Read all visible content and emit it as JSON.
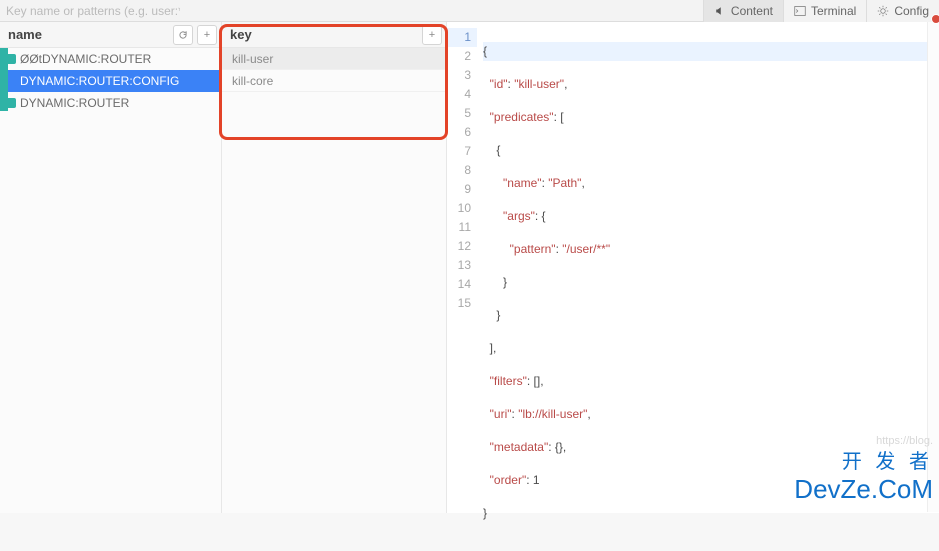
{
  "search": {
    "placeholder": "Key name or patterns (e.g. user:*)"
  },
  "tabs": {
    "content": "Content",
    "terminal": "Terminal",
    "config": "Config"
  },
  "panels": {
    "name": {
      "title": "name",
      "items": [
        {
          "label": "ØØtDYNAMIC:ROUTER",
          "color": "teal",
          "selected": false
        },
        {
          "label": "DYNAMIC:ROUTER:CONFIG",
          "color": "blue",
          "selected": true
        },
        {
          "label": "DYNAMIC:ROUTER",
          "color": "teal",
          "selected": false
        }
      ]
    },
    "key": {
      "title": "key",
      "items": [
        {
          "label": "kill-user",
          "selected": true
        },
        {
          "label": "kill-core",
          "selected": false
        }
      ]
    }
  },
  "code": {
    "line1": "{",
    "k_id": "\"id\"",
    "v_id": "\"kill-user\"",
    "k_predicates": "\"predicates\"",
    "brace_open": "{",
    "k_name": "\"name\"",
    "v_name": "\"Path\"",
    "k_args": "\"args\"",
    "k_pattern": "\"pattern\"",
    "v_pattern": "\"/user/**\"",
    "brace_close": "}",
    "arr_close": "],",
    "k_filters": "\"filters\"",
    "v_filters": "[],",
    "k_uri": "\"uri\"",
    "v_uri": "\"lb://kill-user\"",
    "k_metadata": "\"metadata\"",
    "v_metadata": "{},",
    "k_order": "\"order\"",
    "v_order": "1",
    "line_end": "}"
  },
  "watermark": {
    "url": "https://blog.",
    "name_cn": "开 发 者",
    "name_en": "DevZe.CoM"
  }
}
